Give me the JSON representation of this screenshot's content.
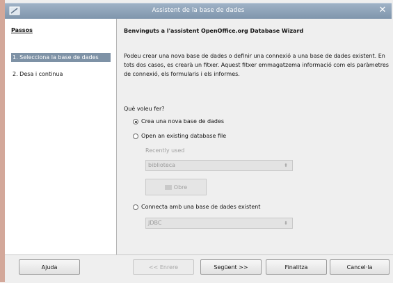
{
  "window": {
    "title": "Assistent de la base de dades"
  },
  "steps": {
    "heading": "Passos",
    "items": [
      {
        "label": "1. Selecciona la base de dades",
        "active": true
      },
      {
        "label": "2. Desa i continua",
        "active": false
      }
    ]
  },
  "main": {
    "header": "Benvinguts a l'assistent OpenOffice.org Database Wizard",
    "intro": "Podeu crear una nova base de dades o definir una connexió a una base de dades existent. En tots dos casos, es crearà un fitxer. Aquest fitxer emmagatzema informació com els paràmetres de connexió, els formularis i els informes.",
    "question": "Què voleu fer?",
    "options": {
      "create_new": {
        "label": "Crea una nova base de dades",
        "checked": true
      },
      "open_existing": {
        "label": "Open an existing database file",
        "checked": false
      },
      "connect_existing": {
        "label": "Connecta amb una base de dades existent",
        "checked": false
      }
    },
    "recently_used_label": "Recently used",
    "recent_combo_value": "biblioteca",
    "open_button_label": "Obre",
    "connection_type_value": "JDBC"
  },
  "footer": {
    "help": "Ajuda",
    "back": "<< Enrere",
    "next": "Següent >>",
    "finish": "Finalitza",
    "cancel": "Cancel·la"
  },
  "colors": {
    "titlebar": "#8ea3b9",
    "selected_step": "#7e92a6",
    "dialog_bg": "#efefef",
    "left_strip": "#d3a89a"
  }
}
